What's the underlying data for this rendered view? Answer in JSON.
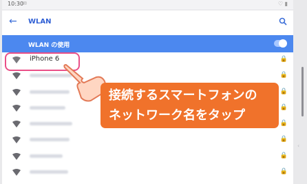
{
  "status_bar": {
    "time": "10:30",
    "signal": "✉",
    "battery": "♡ ▮"
  },
  "app_bar": {
    "back_icon": "arrow-left-icon",
    "title": "WLAN",
    "search_icon": "search-icon"
  },
  "wlan_toggle": {
    "label": "WLAN の使用",
    "enabled": true
  },
  "networks": [
    {
      "name": "iPhone 6",
      "locked": true
    },
    {
      "name": "",
      "locked": true
    },
    {
      "name": "",
      "locked": true
    },
    {
      "name": "",
      "locked": true
    },
    {
      "name": "",
      "locked": true
    },
    {
      "name": "",
      "locked": true
    },
    {
      "name": "",
      "locked": true
    },
    {
      "name": "",
      "locked": true
    }
  ],
  "callout": {
    "line1": "接続するスマートフォンの",
    "line2": "ネットワーク名をタップ"
  },
  "colors": {
    "accent": "#4c88ef",
    "callout": "#f0722b",
    "highlight": "#ea4f87"
  }
}
